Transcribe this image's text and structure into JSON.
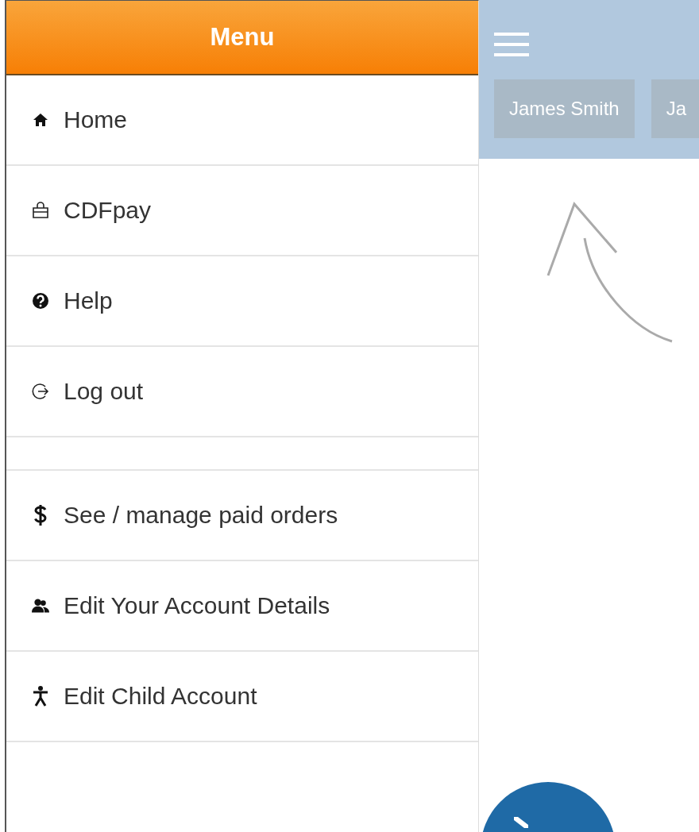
{
  "menu": {
    "title": "Menu",
    "groups": [
      [
        {
          "kind": "home",
          "label": "Home"
        },
        {
          "kind": "bag",
          "label": "CDFpay"
        },
        {
          "kind": "help",
          "label": "Help"
        },
        {
          "kind": "logout",
          "label": "Log out"
        }
      ],
      [
        {
          "kind": "dollar",
          "label": "See / manage paid orders"
        },
        {
          "kind": "users",
          "label": "Edit Your Account Details"
        },
        {
          "kind": "child",
          "label": "Edit Child Account"
        }
      ]
    ]
  },
  "top_bar": {
    "person_buttons": [
      "James Smith",
      "Ja"
    ]
  }
}
